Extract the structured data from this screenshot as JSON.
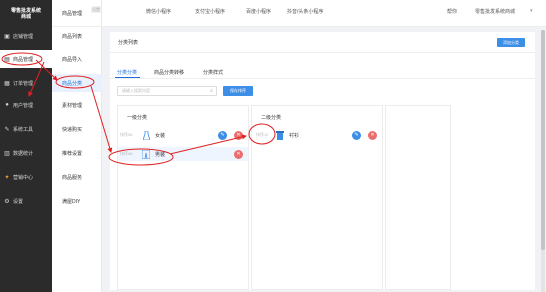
{
  "brand": {
    "line1": "零售批发系统",
    "line2": "商城"
  },
  "sidebar": {
    "items": [
      {
        "label": "店铺管理",
        "icon": "store-icon"
      },
      {
        "label": "商品管理",
        "icon": "product-icon"
      },
      {
        "label": "订单管理",
        "icon": "order-icon"
      },
      {
        "label": "用户管理",
        "icon": "user-icon"
      },
      {
        "label": "系统工具",
        "icon": "tools-icon"
      },
      {
        "label": "数据统计",
        "icon": "chart-icon"
      },
      {
        "label": "营销中心",
        "icon": "marketing-icon"
      },
      {
        "label": "设置",
        "icon": "settings-icon"
      }
    ],
    "active_index": 1
  },
  "submenu": {
    "header": "商品管理",
    "header_badge": "设置",
    "items": [
      {
        "label": "商品列表"
      },
      {
        "label": "商品导入"
      },
      {
        "label": "商品分类"
      },
      {
        "label": "素材管理"
      },
      {
        "label": "快递购买"
      },
      {
        "label": "推荐设置"
      },
      {
        "label": "商品服务"
      },
      {
        "label": "满屋DIY"
      }
    ],
    "active_index": 2
  },
  "topbar": {
    "tabs": [
      "微信小程序",
      "支付宝小程序",
      "百度小程序",
      "抖音/头条小程序"
    ],
    "help": "帮你",
    "shop": "零售批发系统商城"
  },
  "main": {
    "title": "分类列表",
    "add_button": "添加分类",
    "tabs": [
      "分类分类",
      "商品分类转移",
      "分类样式"
    ],
    "active_tab": 0,
    "search_placeholder": "请输入搜索内容",
    "sort_button": "保存排序",
    "level1": {
      "title": "一级分类",
      "rows": [
        {
          "sort": "排序58",
          "name": "女装"
        },
        {
          "sort": "排序68",
          "name": "男装"
        }
      ]
    },
    "level2": {
      "title": "二级分类",
      "rows": [
        {
          "sort": "排序10",
          "name": "衬衫"
        }
      ]
    }
  },
  "colors": {
    "accent": "#3d8ee6",
    "danger": "#ea6e6e",
    "annotation": "#e02020",
    "sidebar_bg": "#2b2b2b"
  }
}
